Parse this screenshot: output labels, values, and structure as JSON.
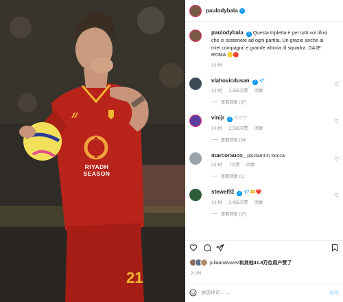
{
  "post": {
    "author": "paulodybala",
    "caption_author": "paulodybala",
    "caption_text": "Questa tripletta è per tutti voi tifosi che ci sostenete ad ogni partita. Un grazie anche ai miei compagni, e grande vittoria di squadra. DAJE ROMA",
    "caption_emojis": "🟡🔴",
    "caption_time": "2小时",
    "jersey_sponsor_line1": "RIYADH",
    "jersey_sponsor_line2": "SEASON",
    "jersey_number": "21"
  },
  "comments": [
    {
      "user": "vlahovicdusan",
      "text": "💎",
      "time": "1小时",
      "likes": "2,355次赞",
      "reply": "回复",
      "view_replies": "查看回复 (37)",
      "avatar_color": "#3c4a57"
    },
    {
      "user": "vinijr",
      "text": "♡♡♡",
      "time": "1小时",
      "likes": "2,596次赞",
      "reply": "回复",
      "view_replies": "查看回复 (39)",
      "avatar_color": "#5a3fa0"
    },
    {
      "user": "marcorauco_",
      "text": "pisciami in bocca",
      "time": "2小时",
      "likes": "7次赞",
      "reply": "回复",
      "view_replies": "查看回复 (1)",
      "avatar_color": "#9aa3ab"
    },
    {
      "user": "stewel92",
      "text": "💎🫶❤️",
      "time": "1小时",
      "likes": "2,456次赞",
      "reply": "回复",
      "view_replies": "查看回复 (37)",
      "avatar_color": "#2f5e3a"
    }
  ],
  "likes": {
    "text_user": "juliaanalvarez",
    "text_rest": "和其他41.8万位用户赞了"
  },
  "post_time": "2小时",
  "comment_input": {
    "placeholder": "添加评论……",
    "post_label": "发布"
  },
  "colors": {
    "verified": "#0095f6",
    "jersey": "#b8231a",
    "accent_ring": "#e1306c"
  }
}
